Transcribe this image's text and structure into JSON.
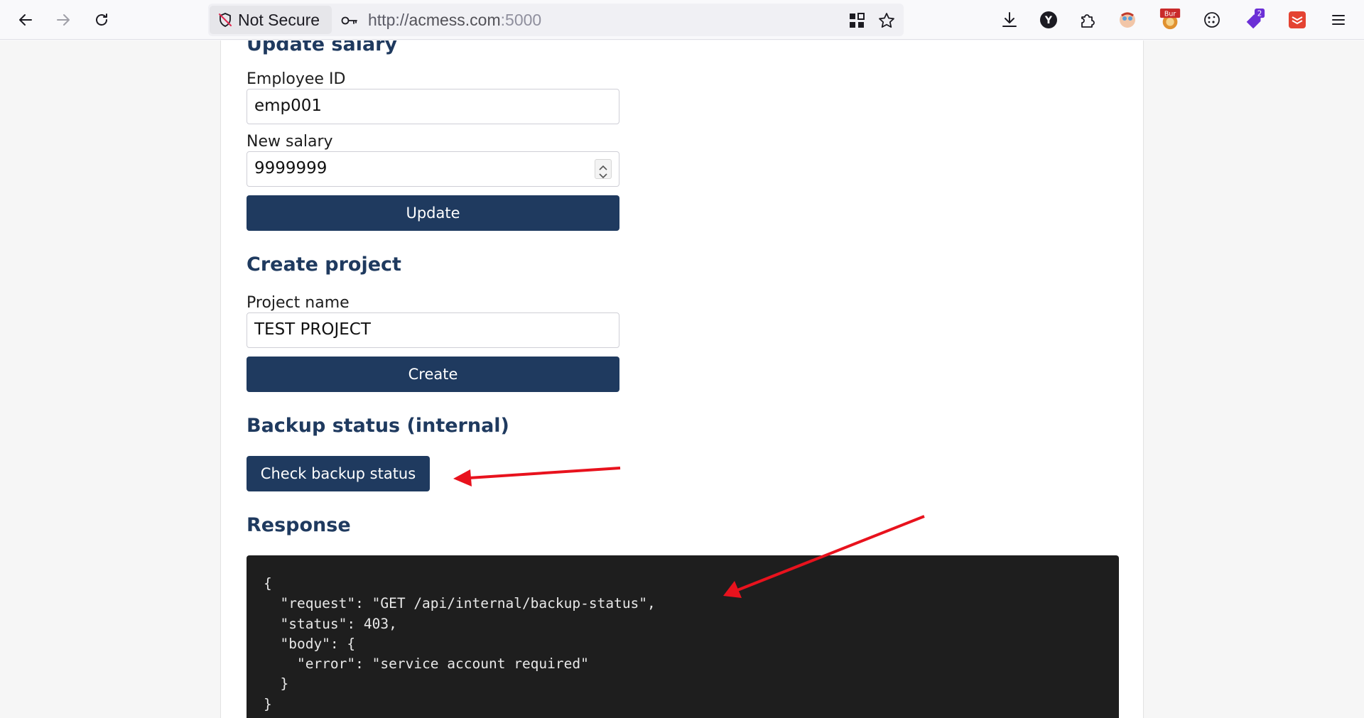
{
  "browser": {
    "security_label": "Not Secure",
    "url_prefix": "http://",
    "url_host": "acmess.com",
    "url_port": ":5000",
    "extensions": [
      {
        "name": "y-extension-icon",
        "glyph": "Y"
      },
      {
        "name": "burp-extension-icon",
        "badge": "Bur"
      },
      {
        "name": "tag-extension-icon",
        "badge": "2"
      }
    ]
  },
  "update_salary": {
    "heading": "Update salary",
    "employee_id_label": "Employee ID",
    "employee_id_value": "emp001",
    "salary_label": "New salary",
    "salary_value": "9999999",
    "button_label": "Update"
  },
  "create_project": {
    "heading": "Create project",
    "project_name_label": "Project name",
    "project_name_value": "TEST PROJECT",
    "button_label": "Create"
  },
  "backup_status": {
    "heading": "Backup status (internal)",
    "button_label": "Check backup status"
  },
  "response": {
    "heading": "Response",
    "body": "{\n  \"request\": \"GET /api/internal/backup-status\",\n  \"status\": 403,\n  \"body\": {\n    \"error\": \"service account required\"\n  }\n}"
  },
  "colors": {
    "primary": "#1f3a5f",
    "annotation_arrow": "#e8121d",
    "code_bg": "#1e1e1e"
  }
}
